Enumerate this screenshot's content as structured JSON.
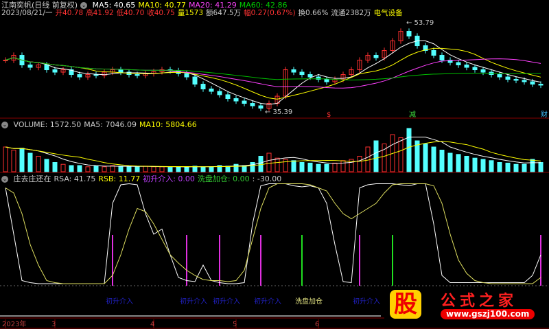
{
  "header": {
    "stock": "江南奕帆(日线 前复权)",
    "ma5": "MA5: 40.65",
    "ma10": "MA10: 40.77",
    "ma20": "MA20: 41.29",
    "ma60": "MA60: 42.86",
    "date": "2023/08/21/一",
    "open": "开40.78",
    "high": "高41.92",
    "low": "低40.70",
    "close": "收40.75",
    "vol": "量1573",
    "amount": "额647.5万",
    "change": "幅0.27(0.67%)",
    "turnover": "换0.66%",
    "float": "流通2382万",
    "sector": "电气设备"
  },
  "price": {
    "max_label": "53.79",
    "min_label": "35.39",
    "marks": [
      {
        "label": "$",
        "i": 39,
        "color": "#ff3030"
      },
      {
        "label": "减",
        "i": 49,
        "color": "#40e040"
      },
      {
        "label": "财",
        "i": 65,
        "color": "#40c0ff"
      }
    ],
    "closes": [
      46,
      47,
      45,
      44.5,
      45,
      44,
      43.5,
      44,
      43,
      42.5,
      43,
      42.8,
      43.5,
      44,
      43.5,
      43,
      42.8,
      43.2,
      43.6,
      44,
      43.8,
      43.2,
      42.5,
      41,
      40,
      39.5,
      38.8,
      38,
      37.5,
      37,
      36.5,
      36,
      37,
      38.5,
      44,
      43.5,
      43,
      42.5,
      42,
      41.5,
      42,
      43,
      44,
      46,
      47,
      46.5,
      48,
      50,
      52,
      51,
      49,
      48,
      47,
      46,
      45.5,
      45,
      44.5,
      44,
      43.5,
      43,
      42.5,
      42,
      41.8,
      41.5,
      41,
      40.8
    ]
  },
  "volume": {
    "title": "VOLUME: 1572.50",
    "ma5": "MA5: 7046.09",
    "ma10": "MA10: 5804.66",
    "values": [
      40,
      35,
      38,
      30,
      25,
      20,
      15,
      12,
      10,
      10,
      8,
      9,
      8,
      10,
      9,
      8,
      8,
      9,
      8,
      8,
      7,
      8,
      8,
      9,
      8,
      8,
      10,
      9,
      12,
      10,
      15,
      25,
      30,
      22,
      20,
      18,
      15,
      14,
      12,
      12,
      14,
      18,
      20,
      25,
      40,
      50,
      45,
      60,
      55,
      70,
      50,
      45,
      40,
      35,
      30,
      28,
      25,
      22,
      20,
      18,
      15,
      14,
      12,
      12,
      20,
      15
    ]
  },
  "indicator": {
    "name": "庄去庄还在",
    "rsa": "RSA: 41.75",
    "rsb": "RSB: 11.77",
    "entry": "初升介入: 0.00",
    "wash": "洗盘加仓: 0.00",
    "extra": ": -30.00",
    "rsa_values": [
      95,
      50,
      5,
      3,
      2,
      2,
      2,
      2,
      2,
      2,
      2,
      2,
      2,
      80,
      98,
      99,
      98,
      70,
      50,
      55,
      30,
      8,
      5,
      4,
      20,
      5,
      3,
      2,
      2,
      3,
      60,
      97,
      99,
      99,
      99,
      97,
      96,
      97,
      95,
      80,
      40,
      4,
      3,
      95,
      98,
      99,
      99,
      99,
      98,
      97,
      99,
      99,
      60,
      10,
      3,
      3,
      3,
      3,
      3,
      3,
      3,
      3,
      3,
      3,
      10,
      30
    ],
    "rsb_values": [
      95,
      90,
      70,
      40,
      20,
      5,
      3,
      2,
      2,
      2,
      2,
      2,
      2,
      10,
      30,
      55,
      75,
      72,
      60,
      45,
      30,
      22,
      15,
      10,
      6,
      5,
      5,
      4,
      5,
      15,
      45,
      75,
      95,
      99,
      99,
      99,
      99,
      98,
      95,
      92,
      80,
      70,
      65,
      70,
      75,
      80,
      90,
      98,
      99,
      99,
      99,
      99,
      97,
      80,
      50,
      25,
      12,
      5,
      3,
      2,
      2,
      2,
      2,
      2,
      2,
      8
    ],
    "entry_idx": [
      13,
      22,
      26,
      31,
      43,
      65
    ],
    "wash_idx": [
      36,
      47
    ],
    "labels": [
      {
        "text": "初升介入",
        "i": 14
      },
      {
        "text": "初升介入",
        "i": 23
      },
      {
        "text": "初升介入",
        "i": 27
      },
      {
        "text": "初升介入",
        "i": 32
      },
      {
        "text": "洗盘加仓",
        "i": 37,
        "wash": true
      },
      {
        "text": "初升介入",
        "i": 44
      }
    ]
  },
  "axis": {
    "labels": [
      {
        "t": "2023年",
        "i": 0
      },
      {
        "t": "3",
        "i": 6
      },
      {
        "t": "4",
        "i": 18
      },
      {
        "t": "5",
        "i": 28
      },
      {
        "t": "6",
        "i": 38
      }
    ]
  },
  "logo": {
    "big": "股",
    "name": "公式之家",
    "url": "www.gszj100.com"
  },
  "colors": {
    "up": "#ff3030",
    "down": "#54ffff",
    "ma5": "#ffffff",
    "ma10": "#ffff00",
    "ma20": "#ff40ff",
    "ma60": "#00c000"
  }
}
